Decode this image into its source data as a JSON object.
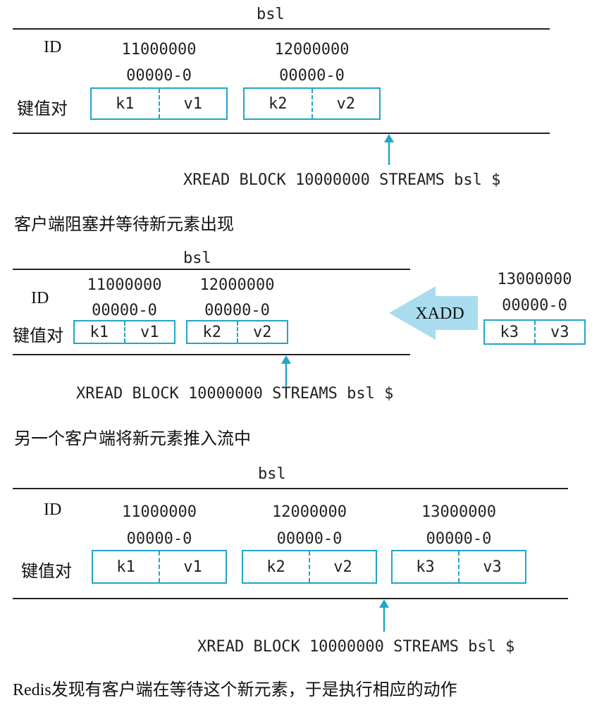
{
  "stream_name": "bsl",
  "id_label": "ID",
  "kv_label": "键值对",
  "command": "XREAD BLOCK 10000000 STREAMS bsl $",
  "xadd_label": "XADD",
  "colors": {
    "accent": "#22a5c8",
    "arrow_fill": "#a9dcee",
    "line": "#222222"
  },
  "panels": [
    {
      "caption": "客户端阻塞并等待新元素出现",
      "entries": [
        {
          "id_top": "11000000",
          "id_bottom": "00000-0",
          "key": "k1",
          "value": "v1"
        },
        {
          "id_top": "12000000",
          "id_bottom": "00000-0",
          "key": "k2",
          "value": "v2"
        }
      ]
    },
    {
      "caption": "另一个客户端将新元素推入流中",
      "entries": [
        {
          "id_top": "11000000",
          "id_bottom": "00000-0",
          "key": "k1",
          "value": "v1"
        },
        {
          "id_top": "12000000",
          "id_bottom": "00000-0",
          "key": "k2",
          "value": "v2"
        }
      ],
      "incoming": {
        "id_top": "13000000",
        "id_bottom": "00000-0",
        "key": "k3",
        "value": "v3"
      }
    },
    {
      "caption": "Redis发现有客户端在等待这个新元素，于是执行相应的动作",
      "entries": [
        {
          "id_top": "11000000",
          "id_bottom": "00000-0",
          "key": "k1",
          "value": "v1"
        },
        {
          "id_top": "12000000",
          "id_bottom": "00000-0",
          "key": "k2",
          "value": "v2"
        },
        {
          "id_top": "13000000",
          "id_bottom": "00000-0",
          "key": "k3",
          "value": "v3"
        }
      ]
    }
  ]
}
